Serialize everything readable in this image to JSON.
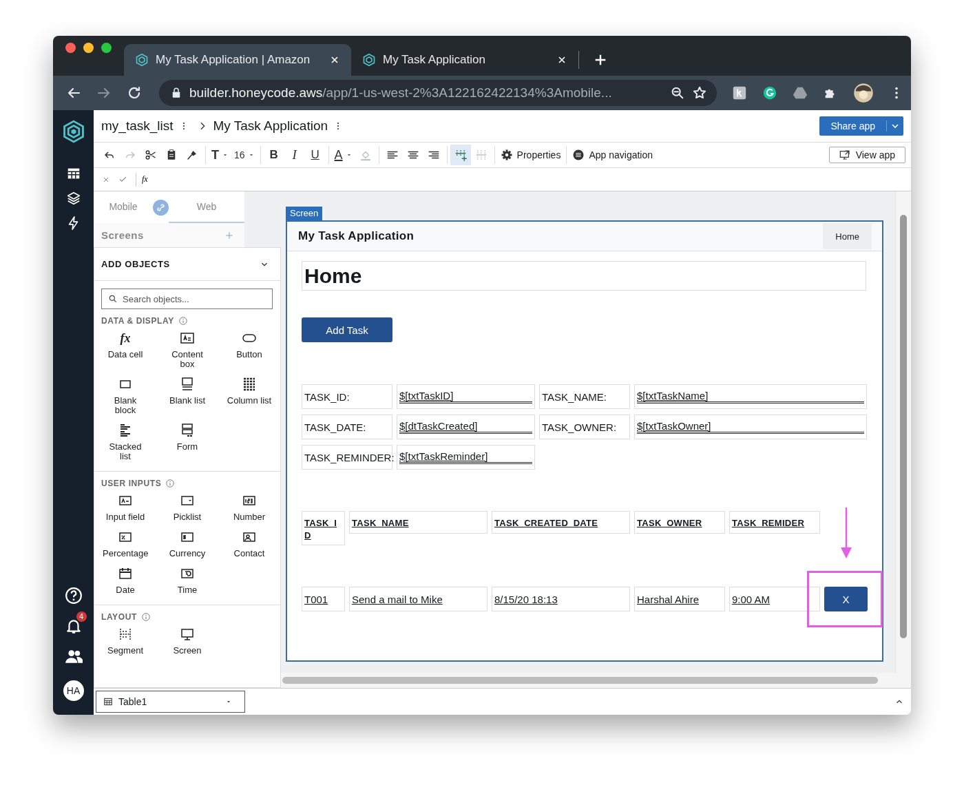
{
  "browser": {
    "tabs": [
      {
        "title": "My Task Application | Amazon",
        "selected": true
      },
      {
        "title": "My Task Application",
        "selected": false
      }
    ],
    "address": {
      "host": "builder.honeycode.aws",
      "path": "/app/1-us-west-2%3A122162422134%3Amobile..."
    }
  },
  "rail": {
    "notifications": "4",
    "avatar": "HA"
  },
  "header": {
    "breadcrumb": [
      {
        "label": "my_task_list"
      },
      {
        "label": "My Task Application"
      }
    ],
    "share_button": "Share app"
  },
  "toolbar": {
    "groups": [
      [
        {
          "kind": "undo",
          "disabled": false,
          "selected": false
        },
        {
          "kind": "redo",
          "disabled": true,
          "selected": false
        },
        {
          "kind": "cut",
          "disabled": false,
          "selected": false
        },
        {
          "kind": "paste",
          "disabled": false,
          "selected": false
        },
        {
          "kind": "format_painter",
          "disabled": false,
          "selected": false
        }
      ],
      [
        {
          "kind": "text_style",
          "label": "T",
          "disabled": false,
          "selected": false
        },
        {
          "kind": "font_size",
          "label": "16",
          "disabled": false,
          "selected": false
        }
      ],
      [
        {
          "kind": "bold",
          "label": "B",
          "disabled": false,
          "selected": false
        },
        {
          "kind": "italic",
          "label": "I",
          "disabled": false,
          "selected": false
        },
        {
          "kind": "underline",
          "label": "U",
          "disabled": false,
          "selected": false
        }
      ],
      [
        {
          "kind": "font_color",
          "label": "A",
          "disabled": false,
          "selected": false
        },
        {
          "kind": "fill_color",
          "disabled": true,
          "selected": false
        }
      ],
      [
        {
          "kind": "align_left",
          "disabled": false,
          "selected": false
        },
        {
          "kind": "align_center",
          "disabled": false,
          "selected": false
        },
        {
          "kind": "align_right",
          "disabled": false,
          "selected": false
        }
      ],
      [
        {
          "kind": "insert_column",
          "disabled": false,
          "selected": true
        },
        {
          "kind": "delete_column",
          "disabled": true,
          "selected": false
        }
      ],
      [
        {
          "kind": "properties",
          "label": "Properties",
          "disabled": false,
          "selected": false
        }
      ],
      [
        {
          "kind": "app_navigation",
          "label": "App navigation",
          "disabled": false,
          "selected": false
        }
      ]
    ],
    "view_app": "View app"
  },
  "formula_bar": {
    "label": "fx"
  },
  "left_panel": {
    "modes": [
      {
        "label": "Mobile",
        "selected": false
      },
      {
        "label": "Web",
        "selected": true
      }
    ],
    "screens_label": "Screens",
    "add_objects": {
      "title": "ADD OBJECTS",
      "expanded": true
    },
    "search": {
      "placeholder": "Search objects..."
    },
    "sections": [
      {
        "title": "DATA & DISPLAY",
        "items": [
          {
            "kind": "data_cell",
            "glyph": "fx",
            "label": "Data cell"
          },
          {
            "kind": "content_box",
            "label": "Content box"
          },
          {
            "kind": "button",
            "label": "Button"
          },
          {
            "kind": "blank_block",
            "label": "Blank block"
          },
          {
            "kind": "blank_list",
            "label": "Blank list"
          },
          {
            "kind": "column_list",
            "label": "Column list"
          },
          {
            "kind": "stacked_list",
            "label": "Stacked list"
          },
          {
            "kind": "form",
            "label": "Form"
          }
        ]
      },
      {
        "title": "USER INPUTS",
        "items": [
          {
            "kind": "input_field",
            "label": "Input field"
          },
          {
            "kind": "picklist",
            "label": "Picklist"
          },
          {
            "kind": "number",
            "label": "Number"
          },
          {
            "kind": "percentage",
            "label": "Percentage"
          },
          {
            "kind": "currency",
            "label": "Currency"
          },
          {
            "kind": "contact",
            "label": "Contact"
          },
          {
            "kind": "date",
            "label": "Date"
          },
          {
            "kind": "time",
            "label": "Time"
          }
        ]
      },
      {
        "title": "LAYOUT",
        "items": [
          {
            "kind": "segment",
            "label": "Segment"
          },
          {
            "kind": "screen",
            "label": "Screen"
          }
        ]
      }
    ]
  },
  "canvas": {
    "screen_tag": "Screen",
    "app_title": "My Task Application",
    "nav": [
      {
        "label": "Home",
        "selected": true
      }
    ],
    "heading": "Home",
    "add_button": "Add Task",
    "fields": [
      {
        "label": "TASK_ID:",
        "value": "$[txtTaskID]"
      },
      {
        "label": "TASK_NAME:",
        "value": "$[txtTaskName]"
      },
      {
        "label": "TASK_DATE:",
        "value": "$[dtTaskCreated]"
      },
      {
        "label": "TASK_OWNER:",
        "value": "$[txtTaskOwner]"
      },
      {
        "label": "TASK_REMINDER:",
        "value": "$[txtTaskReminder]"
      }
    ],
    "columns": [
      "TASK_ID",
      "TASK_NAME",
      "TASK_CREATED_DATE",
      "TASK_OWNER",
      "TASK_REMIDER"
    ],
    "rows": [
      {
        "cells": [
          "T001",
          "Send a mail to Mike",
          "8/15/20 18:13",
          "Harshal Ahire",
          "9:00 AM"
        ],
        "delete_button": "X",
        "highlighted": true
      }
    ]
  },
  "bottom_bar": {
    "table_select": "Table1"
  }
}
